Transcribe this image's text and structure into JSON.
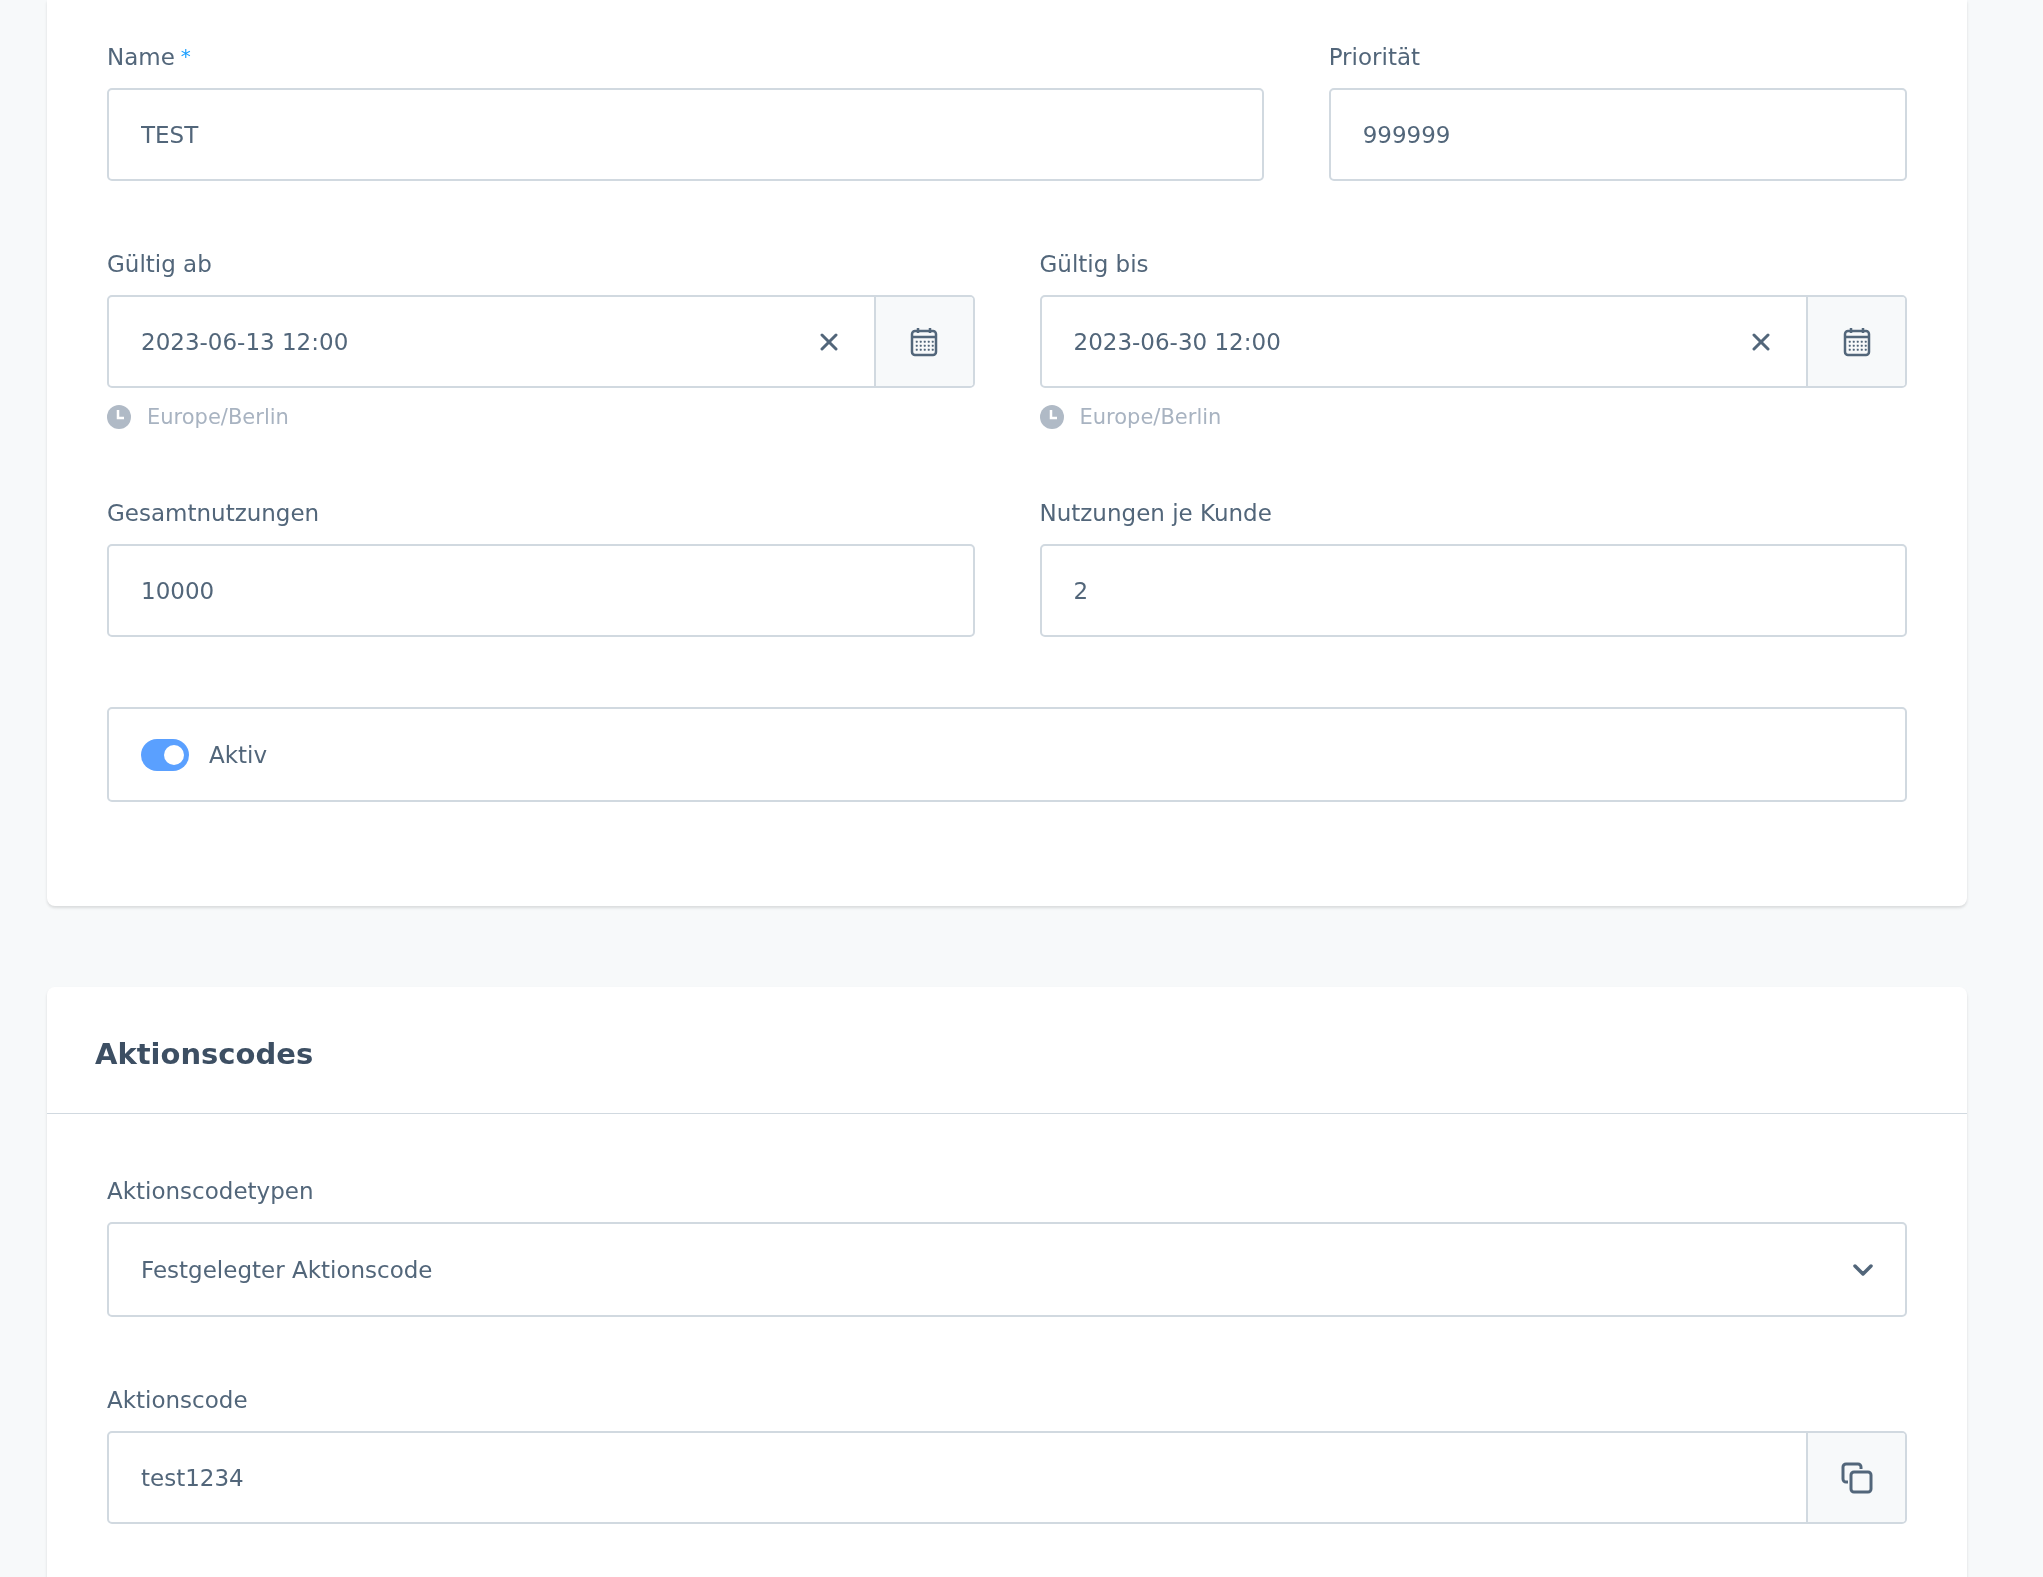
{
  "general_card": {
    "name_field": {
      "label": "Name",
      "required_mark": "*",
      "value": "TEST"
    },
    "priority_field": {
      "label": "Priorität",
      "value": "999999"
    },
    "valid_from": {
      "label": "Gültig ab",
      "value": "2023-06-13 12:00",
      "timezone": "Europe/Berlin"
    },
    "valid_to": {
      "label": "Gültig bis",
      "value": "2023-06-30 12:00",
      "timezone": "Europe/Berlin"
    },
    "total_uses": {
      "label": "Gesamtnutzungen",
      "value": "10000"
    },
    "uses_per_customer": {
      "label": "Nutzungen je Kunde",
      "value": "2"
    },
    "active_toggle": {
      "label": "Aktiv",
      "on": true
    }
  },
  "codes_card": {
    "title": "Aktionscodes",
    "type_select": {
      "label": "Aktionscodetypen",
      "value": "Festgelegter Aktionscode"
    },
    "code_field": {
      "label": "Aktionscode",
      "value": "test1234"
    }
  }
}
